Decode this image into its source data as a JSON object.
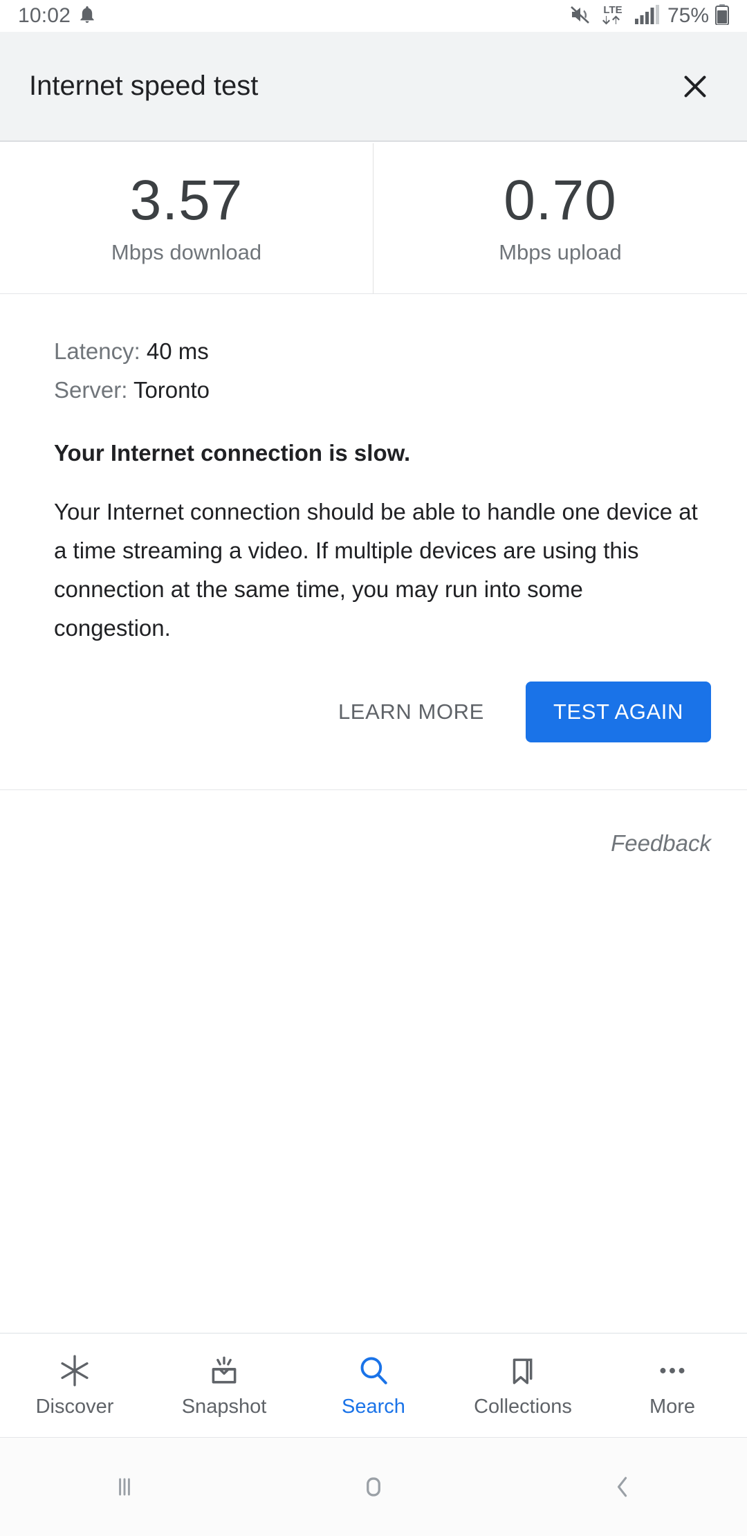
{
  "status_bar": {
    "time": "10:02",
    "notification_icon": "bell-icon",
    "mute_icon": "volume-mute-icon",
    "network_type": "LTE",
    "data_arrows_icon": "data-transfer-arrows-icon",
    "signal_icon": "signal-bars-icon",
    "signal_bars_filled": 4,
    "signal_bars_total": 5,
    "battery_percent": "75%",
    "battery_icon": "battery-icon"
  },
  "header": {
    "title": "Internet speed test",
    "close_icon": "close-icon"
  },
  "speeds": [
    {
      "value": "3.57",
      "label": "Mbps download"
    },
    {
      "value": "0.70",
      "label": "Mbps upload"
    }
  ],
  "details": {
    "latency_label": "Latency: ",
    "latency_value": "40 ms",
    "server_label": "Server: ",
    "server_value": "Toronto",
    "headline": "Your Internet connection is slow.",
    "paragraph": "Your Internet connection should be able to handle one device at a time streaming a video. If multiple devices are using this connection at the same time, you may run into some congestion."
  },
  "actions": {
    "learn_more_label": "LEARN MORE",
    "test_again_label": "TEST AGAIN"
  },
  "feedback": {
    "label": "Feedback"
  },
  "bottom_nav": {
    "items": [
      {
        "label": "Discover",
        "icon": "discover-asterisk-icon",
        "active": false
      },
      {
        "label": "Snapshot",
        "icon": "snapshot-inbox-icon",
        "active": false
      },
      {
        "label": "Search",
        "icon": "search-icon",
        "active": true
      },
      {
        "label": "Collections",
        "icon": "bookmark-icon",
        "active": false
      },
      {
        "label": "More",
        "icon": "more-dots-icon",
        "active": false
      }
    ]
  },
  "system_nav": {
    "recents_icon": "recents-icon",
    "home_icon": "home-icon",
    "back_icon": "back-icon"
  },
  "colors": {
    "accent": "#1a73e8",
    "header_bg": "#f1f3f4",
    "text_primary": "#202124",
    "text_secondary": "#70757a",
    "divider": "#e4e6e8"
  }
}
